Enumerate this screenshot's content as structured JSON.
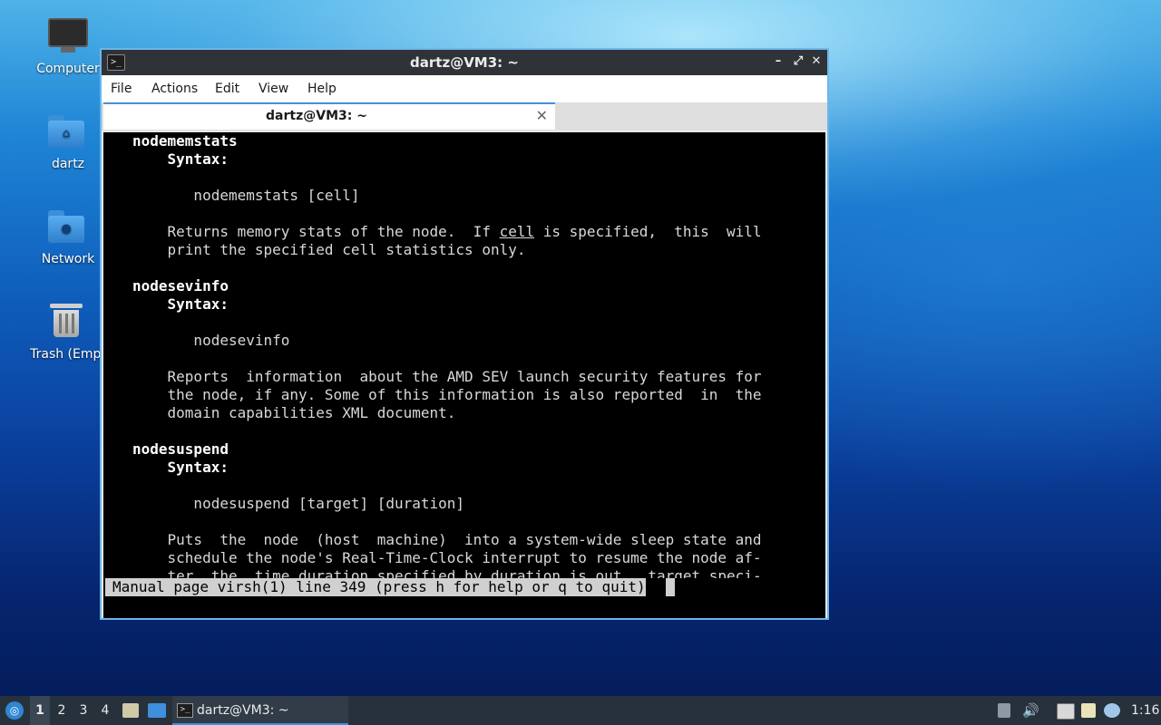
{
  "desktop": {
    "icons": [
      {
        "label": "Computer",
        "icon": "computer-icon"
      },
      {
        "label": "dartz",
        "icon": "home-folder-icon"
      },
      {
        "label": "Network",
        "icon": "network-folder-icon"
      },
      {
        "label": "Trash (Empt",
        "icon": "trash-icon"
      }
    ]
  },
  "window": {
    "title": "dartz@VM3: ~",
    "controls": {
      "minimize": "–",
      "maximize": "⤢",
      "close": "✕"
    },
    "menu": [
      "File",
      "Actions",
      "Edit",
      "View",
      "Help"
    ],
    "tab": {
      "title": "dartz@VM3: ~",
      "close": "✕"
    },
    "accent_color": "#6cb6ea"
  },
  "terminal": {
    "lines": [
      "nodememstats",
      "    Syntax:",
      "",
      "       nodememstats [cell]",
      "",
      "    Returns memory stats of the node.  If cell is specified,  this  will",
      "    print the specified cell statistics only.",
      "",
      "nodesevinfo",
      "    Syntax:",
      "",
      "       nodesevinfo",
      "",
      "    Reports  information  about the AMD SEV launch security features for",
      "    the node, if any. Some of this information is also reported  in  the",
      "    domain capabilities XML document.",
      "",
      "nodesuspend",
      "    Syntax:",
      "",
      "       nodesuspend [target] [duration]",
      "",
      "    Puts  the  node  (host  machine)  into a system-wide sleep state and",
      "    schedule the node's Real-Time-Clock interrupt to resume the node af-",
      "    ter  the  time duration specified by duration is out.  target speci-"
    ],
    "status": "Manual page virsh(1) line 349 (press h for help or q to quit)"
  },
  "taskbar": {
    "workspaces": [
      "1",
      "2",
      "3",
      "4"
    ],
    "active_workspace": "1",
    "task": "dartz@VM3: ~",
    "clock": "1:16"
  }
}
